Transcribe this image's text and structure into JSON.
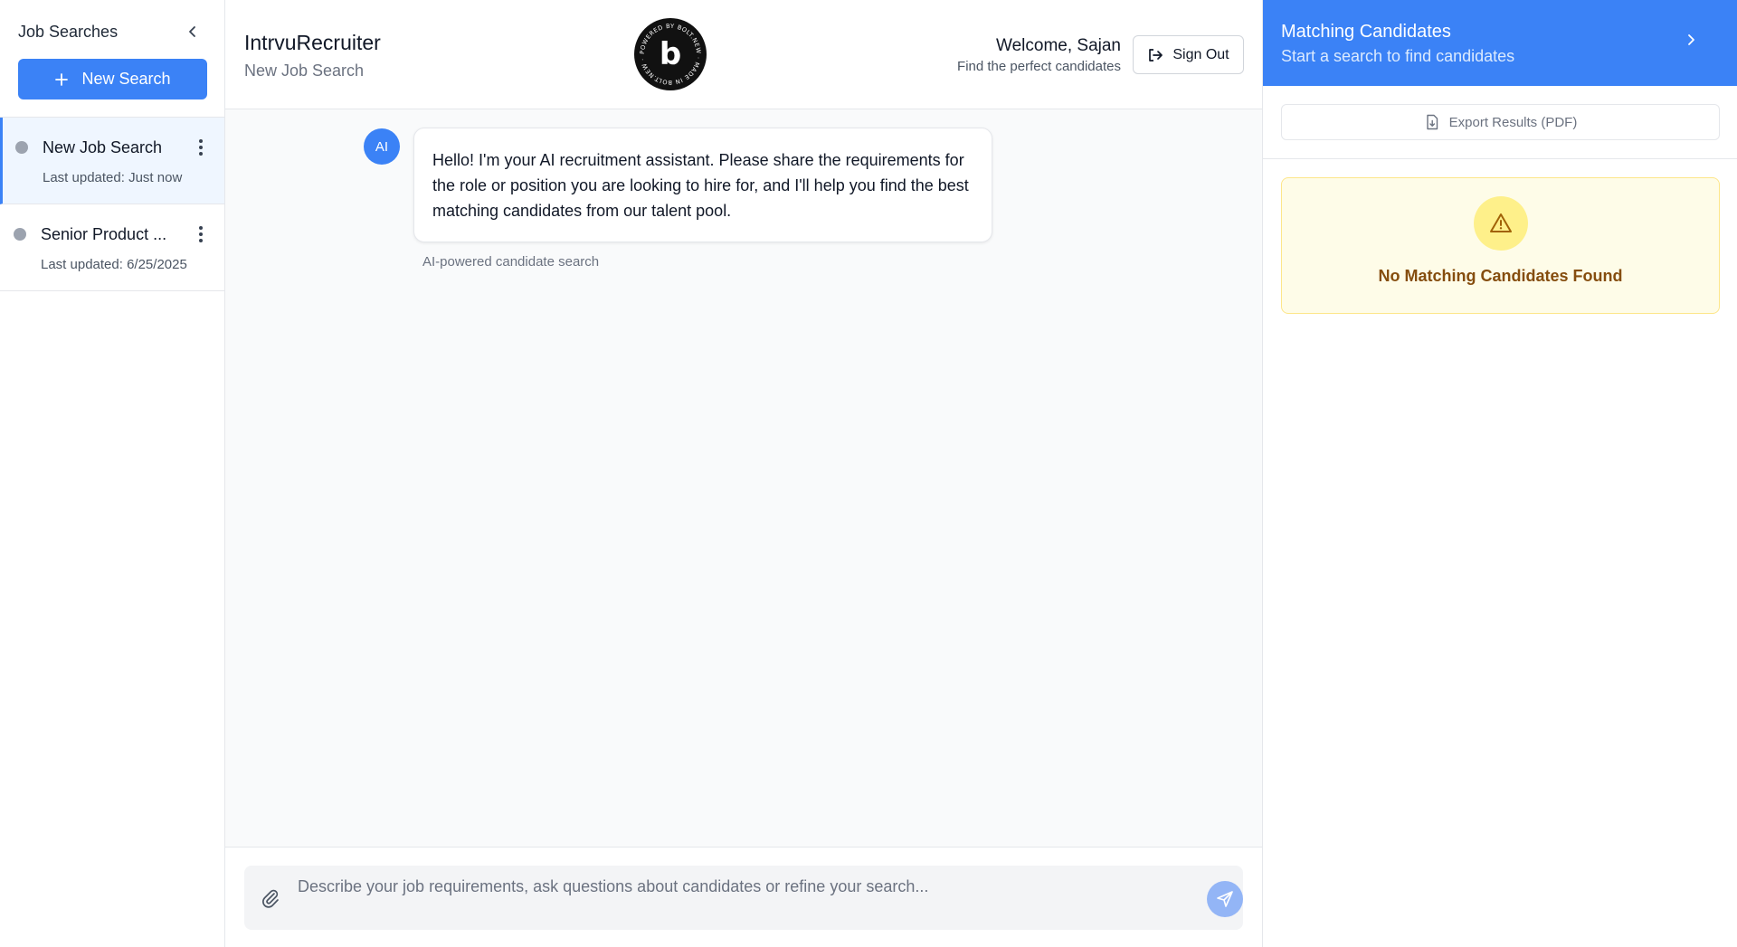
{
  "sidebar": {
    "title": "Job Searches",
    "new_search_label": "New Search",
    "items": [
      {
        "name": "New Job Search",
        "updated": "Last updated: Just now",
        "active": true
      },
      {
        "name": "Senior Product ...",
        "updated": "Last updated: 6/25/2025",
        "active": false
      }
    ]
  },
  "header": {
    "app_name": "IntrvuRecruiter",
    "page_subtitle": "New Job Search",
    "badge_text": "POWERED BY BOLT.NEW · MADE IN BOLT.NEW ·",
    "badge_letter": "b",
    "welcome": "Welcome, Sajan",
    "welcome_sub": "Find the perfect candidates",
    "signout_label": "Sign Out"
  },
  "chat": {
    "avatar_label": "AI",
    "message": "Hello! I'm your AI recruitment assistant. Please share the requirements for the role or position you are looking to hire for, and I'll help you find the best matching candidates from our talent pool.",
    "caption": "AI-powered candidate search"
  },
  "composer": {
    "placeholder": "Describe your job requirements, ask questions about candidates or refine your search...",
    "value": ""
  },
  "results": {
    "title": "Matching Candidates",
    "subtitle": "Start a search to find candidates",
    "export_label": "Export Results (PDF)",
    "empty_text": "No Matching Candidates Found"
  },
  "colors": {
    "accent": "#3b82f6",
    "warning_bg": "#fefce8",
    "warning_text": "#854d0e"
  }
}
